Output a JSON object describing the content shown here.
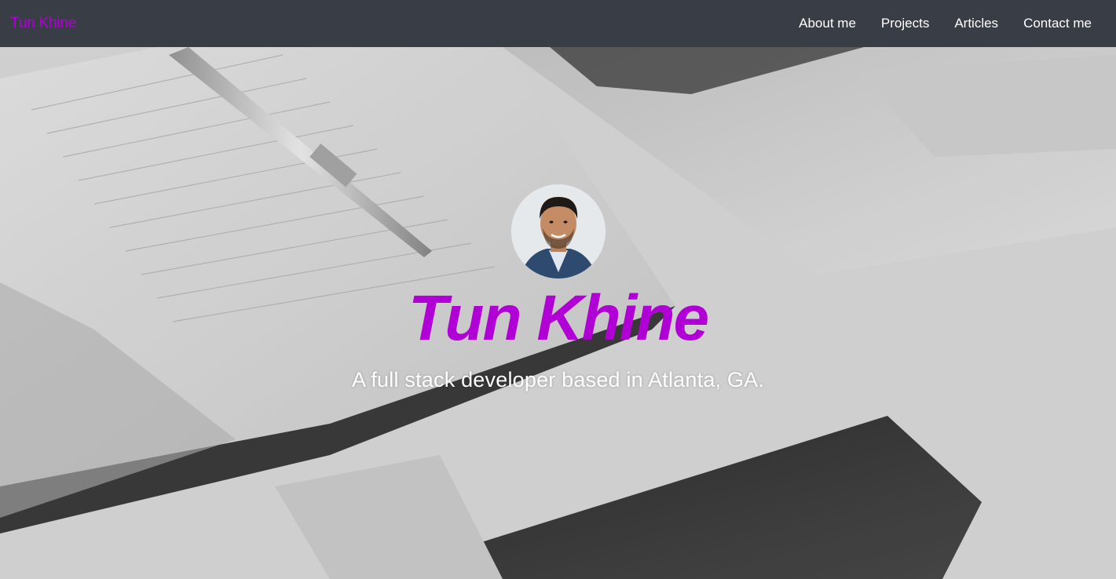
{
  "navbar": {
    "brand": "Tun Khine",
    "links": [
      {
        "label": "About me"
      },
      {
        "label": "Projects"
      },
      {
        "label": "Articles"
      },
      {
        "label": "Contact me"
      }
    ]
  },
  "hero": {
    "title": "Tun Khine",
    "subtitle": "A full stack developer based in Atlanta, GA.",
    "avatar_icon": "avatar-photo",
    "background": "notebook-pen-laptop-phone-photo"
  },
  "colors": {
    "navbar_bg": "#393d46",
    "accent": "#b000d6",
    "nav_text": "#ffffff"
  }
}
